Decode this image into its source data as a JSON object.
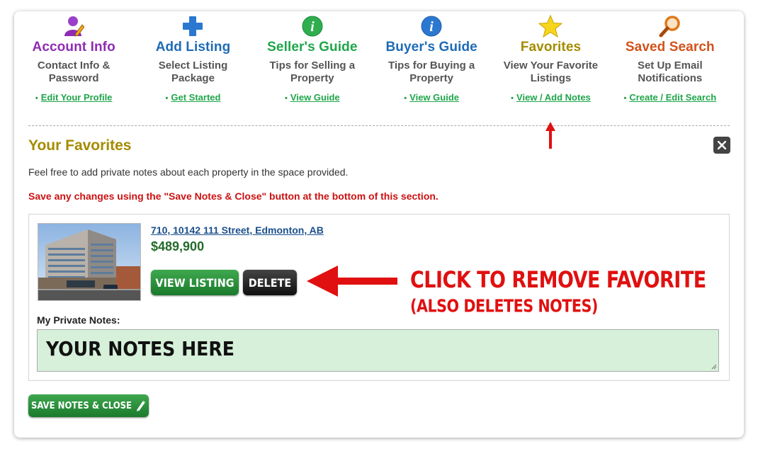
{
  "nav": [
    {
      "title": "Account Info",
      "desc": "Contact Info & Password",
      "link": "Edit Your Profile",
      "color": "#8e2cb3",
      "icon": "user-edit-icon"
    },
    {
      "title": "Add Listing",
      "desc": "Select Listing Package",
      "link": "Get Started",
      "color": "#1f6bb5",
      "icon": "plus-icon"
    },
    {
      "title": "Seller's Guide",
      "desc": "Tips for Selling a Property",
      "link": "View Guide",
      "color": "#1fa64a",
      "icon": "info-icon-green"
    },
    {
      "title": "Buyer's Guide",
      "desc": "Tips for Buying a Property",
      "link": "View Guide",
      "color": "#1f6bb5",
      "icon": "info-icon-blue"
    },
    {
      "title": "Favorites",
      "desc": "View Your Favorite Listings",
      "link": "View / Add Notes",
      "color": "#a48b00",
      "icon": "star-icon"
    },
    {
      "title": "Saved Search",
      "desc": "Set Up Email Notifications",
      "link": "Create / Edit Search",
      "color": "#d2521b",
      "icon": "magnifier-icon"
    }
  ],
  "favorites": {
    "title": "Your Favorites",
    "info": "Feel free to add private notes about each property in the space provided.",
    "warning": "Save any changes using the \"Save Notes & Close\" button at the bottom of this section.",
    "listing": {
      "address": "710, 10142 111 Street, Edmonton, AB",
      "price": "$489,900",
      "view_label": "VIEW LISTING",
      "delete_label": "DELETE"
    },
    "callout_line1": "CLICK TO REMOVE FAVORITE",
    "callout_line2": "(ALSO DELETES NOTES)",
    "notes_label": "My Private Notes:",
    "notes_value": "YOUR NOTES HERE",
    "save_label": "SAVE NOTES & CLOSE"
  }
}
